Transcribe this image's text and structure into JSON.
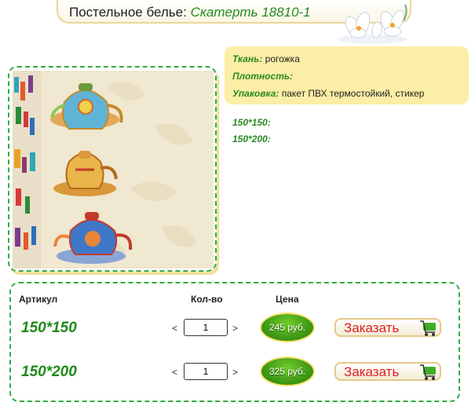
{
  "header": {
    "category": "Постельное белье:",
    "product": "Скатерть 18810-1"
  },
  "specs": [
    {
      "key": "Ткань:",
      "value": "рогожка"
    },
    {
      "key": "Плотность:",
      "value": ""
    },
    {
      "key": "Упаковка:",
      "value": "пакет ПВХ термостойкий, стикер"
    }
  ],
  "sizes": [
    "150*150:",
    "150*200:"
  ],
  "table": {
    "col_article": "Артикул",
    "col_qty": "Кол-во",
    "col_price": "Цена",
    "rows": [
      {
        "article": "150*150",
        "qty": "1",
        "price": "245 руб.",
        "order_label": "Заказать",
        "dec": "<",
        "inc": ">"
      },
      {
        "article": "150*200",
        "qty": "1",
        "price": "325 руб.",
        "order_label": "Заказать",
        "dec": "<",
        "inc": ">"
      }
    ]
  },
  "icons": {
    "flowers": "white-crocus-flowers-icon",
    "cart": "green-cart-icon"
  },
  "colors": {
    "accent_green": "#238a1e",
    "spec_bg": "#fbeea6",
    "price_badge": "#3f9a15",
    "order_text": "#e11b22"
  }
}
